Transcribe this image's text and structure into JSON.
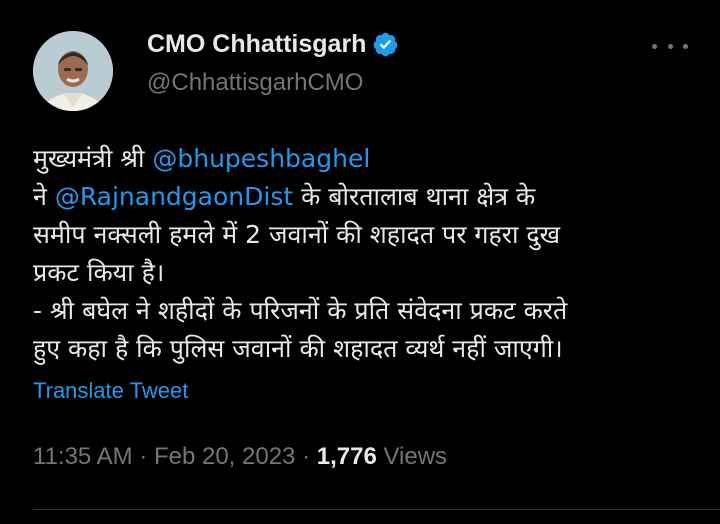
{
  "author": {
    "display_name": "CMO Chhattisgarh",
    "handle": "@ChhattisgarhCMO",
    "verified": true,
    "avatar_icon": "profile-photo"
  },
  "tweet": {
    "lines": [
      {
        "text_before": "मुख्यमंत्री श्री ",
        "mention": "@bhupeshbaghel",
        "text_after": ""
      },
      {
        "text_before": "ने ",
        "mention": "@RajnandgaonDist",
        "text_after": " के बोरतालाब थाना क्षेत्र के"
      },
      {
        "text_before": "समीप नक्सली हमले में 2 जवानों की शहादत पर गहरा दुख",
        "mention": "",
        "text_after": ""
      },
      {
        "text_before": "प्रकट किया है।",
        "mention": "",
        "text_after": ""
      },
      {
        "text_before": "- श्री बघेल ने शहीदों के परिजनों के प्रति संवेदना प्रकट करते",
        "mention": "",
        "text_after": ""
      },
      {
        "text_before": "हुए कहा है कि पुलिस जवानों की शहादत व्यर्थ नहीं जाएगी।",
        "mention": "",
        "text_after": ""
      }
    ],
    "translate_label": "Translate Tweet"
  },
  "meta": {
    "time": "11:35 AM",
    "separator": " · ",
    "date": "Feb 20, 2023",
    "views_count": "1,776",
    "views_label": " Views"
  },
  "colors": {
    "background": "#000000",
    "text": "#e7e9ea",
    "secondary": "#71767b",
    "accent": "#1d9bf0",
    "verified_badge": "#1d9bf0"
  },
  "icons": {
    "more": "more-options-icon",
    "verified": "verified-badge-icon"
  }
}
